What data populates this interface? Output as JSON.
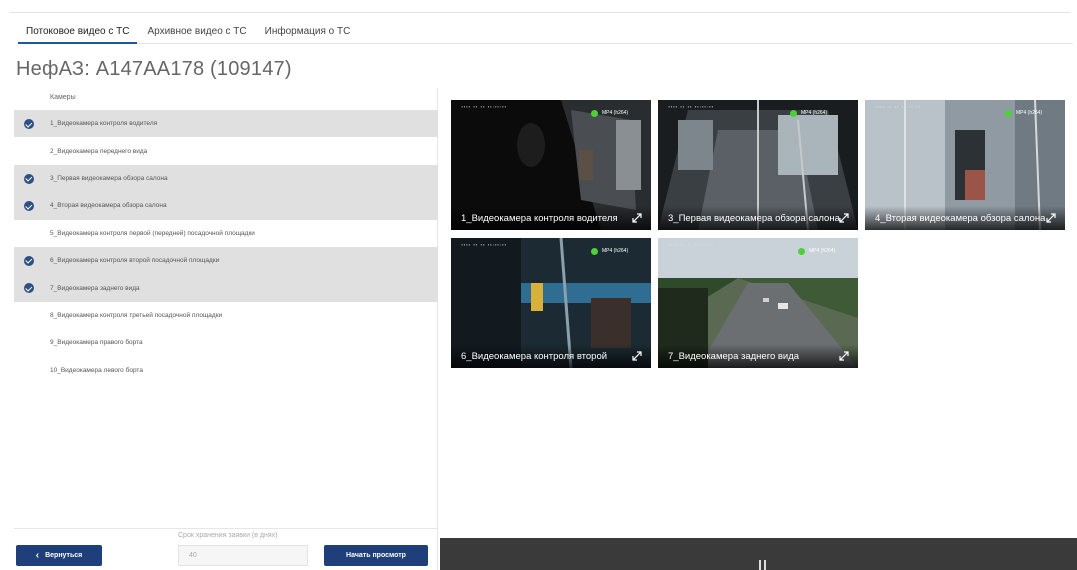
{
  "tabs": [
    {
      "label": "Потоковое видео с ТС",
      "active": true
    },
    {
      "label": "Архивное видео с ТС",
      "active": false
    },
    {
      "label": "Информация о ТС",
      "active": false
    }
  ],
  "page_title": "НефАЗ: А147АА178 (109147)",
  "camera_list": {
    "header": "Камеры",
    "items": [
      {
        "label": "1_Видеокамера контроля водителя",
        "selected": true
      },
      {
        "label": "2_Видеокамера переднего вида",
        "selected": false
      },
      {
        "label": "3_Первая видеокамера обзора салона",
        "selected": true
      },
      {
        "label": "4_Вторая видеокамера обзора салона",
        "selected": true
      },
      {
        "label": "5_Видеокамера контроля первой (передней) посадочной площадки",
        "selected": false
      },
      {
        "label": "6_Видеокамера контроля второй посадочной площадки",
        "selected": true
      },
      {
        "label": "7_Видеокамера заднего вида",
        "selected": true
      },
      {
        "label": "8_Видеокамера контроля третьей посадочной площадки",
        "selected": false
      },
      {
        "label": "9_Видеокамера правого борта",
        "selected": false
      },
      {
        "label": "10_Видеокамера левого борта",
        "selected": false
      }
    ]
  },
  "footer": {
    "back_label": "Вернуться",
    "retention_label": "Срок хранения заявки (в днях)",
    "retention_value": "40",
    "start_label": "Начать просмотр"
  },
  "video_tiles": [
    {
      "caption": "1_Видеокамера контроля водителя",
      "codec": "MP4 (h264)",
      "status_color": "#4cd137"
    },
    {
      "caption": "3_Первая видеокамера обзора салона",
      "codec": "MP4 (h264)",
      "status_color": "#4cd137"
    },
    {
      "caption": "4_Вторая видеокамера обзора салона",
      "codec": "MP4 (h264)",
      "status_color": "#4cd137"
    },
    {
      "caption": "6_Видеокамера контроля второй",
      "codec": "MP4 (h264)",
      "status_color": "#4cd137"
    },
    {
      "caption": "7_Видеокамера заднего вида",
      "codec": "MP4 (h264)",
      "status_color": "#4cd137"
    }
  ],
  "icons": {
    "check": "check-circle-icon",
    "back": "chevron-left-icon",
    "expand": "expand-arrows-icon",
    "pause": "pause-icon"
  },
  "colors": {
    "primary_button": "#1e3f7a",
    "check": "#2b4f86",
    "selected_row": "#e0e0e0",
    "status_online": "#4cd137",
    "player_bar": "#3a3a3a"
  }
}
